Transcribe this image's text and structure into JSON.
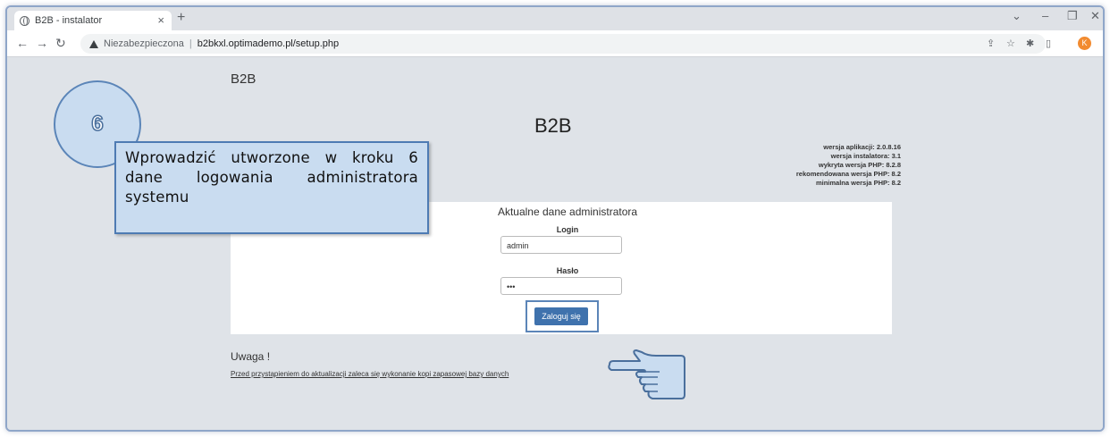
{
  "browser": {
    "tab_title": "B2B - instalator",
    "tab_close": "×",
    "new_tab": "+",
    "insecure_label": "Niezabezpieczona",
    "url": "b2bkxl.optimademo.pl/setup.php",
    "profile_initial": "K",
    "icons": [
      "back-icon",
      "forward-icon",
      "reload-icon",
      "share-icon",
      "star-icon",
      "extensions-icon",
      "sidepanel-icon",
      "menu-icon"
    ]
  },
  "page": {
    "brand_small": "B2B",
    "brand_big": "B2B",
    "versions": [
      "wersja aplikacji: 2.0.8.16",
      "wersja instalatora: 3.1",
      "wykryta wersja PHP: 8.2.8",
      "rekomendowana wersja PHP: 8.2",
      "minimalna wersja PHP: 8.2"
    ],
    "form": {
      "title": "Aktualne dane administratora",
      "login_label": "Login",
      "login_value": "admin",
      "password_label": "Hasło",
      "password_value": "•••",
      "submit_label": "Zaloguj się"
    },
    "warning_title": "Uwaga !",
    "warning_text": "Przed przystąpieniem do aktualizacji zaleca się wykonanie kopi zapasowej bazy danych"
  },
  "annotation": {
    "step_number": "6",
    "callout_text": "Wprowadzić utworzone w kroku 6 dane logowania administratora systemu"
  },
  "colors": {
    "accent": "#3f72ad",
    "callout_bg": "#c9dcf0",
    "page_bg": "#dfe3e8"
  }
}
